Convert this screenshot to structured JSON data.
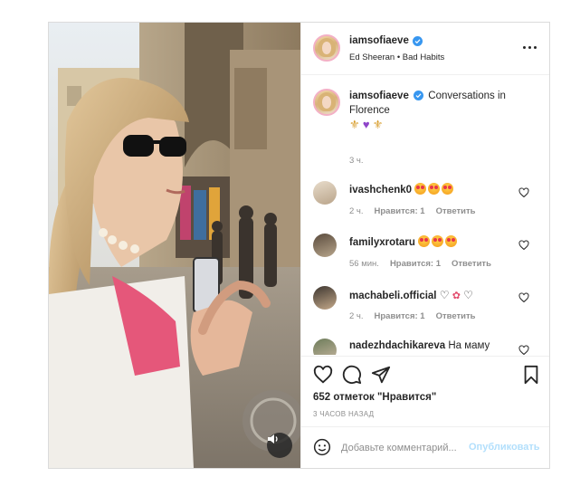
{
  "post": {
    "author": "iamsofiaeve",
    "music": "Ed Sheeran • Bad Habits"
  },
  "caption": {
    "username": "iamsofiaeve",
    "text": "Conversations in Florence",
    "emojis": [
      "fleur-de-lis",
      "purple-heart",
      "fleur-de-lis"
    ],
    "time": "3 ч."
  },
  "comments": [
    {
      "username": "ivashchenk0",
      "emojis": [
        "heart-eyes",
        "heart-eyes",
        "heart-eyes"
      ],
      "time": "2 ч.",
      "likes": "Нравится: 1",
      "reply": "Ответить"
    },
    {
      "username": "familyxrotaru",
      "emojis": [
        "heart-eyes",
        "heart-eyes",
        "heart-eyes"
      ],
      "time": "56 мин.",
      "likes": "Нравится: 1",
      "reply": "Ответить"
    },
    {
      "username": "machabeli.official",
      "emojis": [
        "white-heart",
        "tulip",
        "white-heart"
      ],
      "time": "2 ч.",
      "likes": "Нравится: 1",
      "reply": "Ответить"
    },
    {
      "username": "nadezhdachikareva",
      "text": "На маму Светлану очень похожа. Будь счастлива Сонечка!"
    }
  ],
  "likes_text": "652 отметок \"Нравится\"",
  "time_ago": "3 часов назад",
  "add_comment": {
    "placeholder": "Добавьте комментарий...",
    "publish_label": "Опубликовать"
  },
  "colors": {
    "verified": "#3897f0",
    "publish_disabled": "#b2dffc",
    "meta_gray": "#8e8e8e"
  }
}
